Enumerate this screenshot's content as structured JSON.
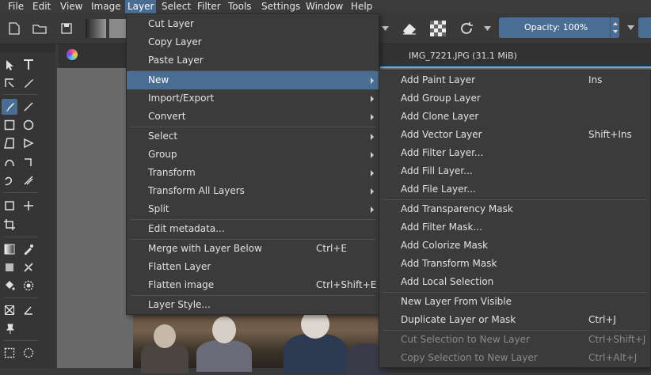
{
  "menubar": [
    "File",
    "Edit",
    "View",
    "Image",
    "Layer",
    "Select",
    "Filter",
    "Tools",
    "Settings",
    "Window",
    "Help"
  ],
  "toolbar": {
    "opacity_label": "Opacity: 100%"
  },
  "document": {
    "tab_title": "IMG_7221.JPG (31.1 MiB)"
  },
  "layer_menu": [
    {
      "label": "Cut Layer"
    },
    {
      "label": "Copy Layer"
    },
    {
      "label": "Paste Layer"
    },
    {
      "label": "New",
      "submenu": true,
      "highlighted": true
    },
    {
      "label": "Import/Export",
      "submenu": true
    },
    {
      "label": "Convert",
      "submenu": true
    },
    {
      "label": "Select",
      "submenu": true
    },
    {
      "label": "Group",
      "submenu": true
    },
    {
      "label": "Transform",
      "submenu": true
    },
    {
      "label": "Transform All Layers",
      "submenu": true
    },
    {
      "label": "Split",
      "submenu": true
    },
    {
      "label": "Edit metadata..."
    },
    {
      "label": "Merge with Layer Below",
      "shortcut": "Ctrl+E"
    },
    {
      "label": "Flatten Layer"
    },
    {
      "label": "Flatten image",
      "shortcut": "Ctrl+Shift+E"
    },
    {
      "label": "Layer Style..."
    }
  ],
  "new_submenu": [
    {
      "label": "Add Paint Layer",
      "shortcut": "Ins"
    },
    {
      "label": "Add Group Layer"
    },
    {
      "label": "Add Clone Layer"
    },
    {
      "label": "Add Vector Layer",
      "shortcut": "Shift+Ins"
    },
    {
      "label": "Add Filter Layer..."
    },
    {
      "label": "Add Fill Layer..."
    },
    {
      "label": "Add File Layer..."
    },
    {
      "label": "Add Transparency Mask"
    },
    {
      "label": "Add Filter Mask..."
    },
    {
      "label": "Add Colorize Mask"
    },
    {
      "label": "Add Transform Mask"
    },
    {
      "label": "Add Local Selection"
    },
    {
      "label": "New Layer From Visible"
    },
    {
      "label": "Duplicate Layer or Mask",
      "shortcut": "Ctrl+J"
    },
    {
      "label": "Cut Selection to New Layer",
      "shortcut": "Ctrl+Shift+J",
      "disabled": true
    },
    {
      "label": "Copy Selection to New Layer",
      "shortcut": "Ctrl+Alt+J",
      "disabled": true
    }
  ],
  "colors": {
    "accent": "#4a6e93",
    "menu_bg": "#3b3b3b",
    "disabled": "#8a8a8a"
  }
}
